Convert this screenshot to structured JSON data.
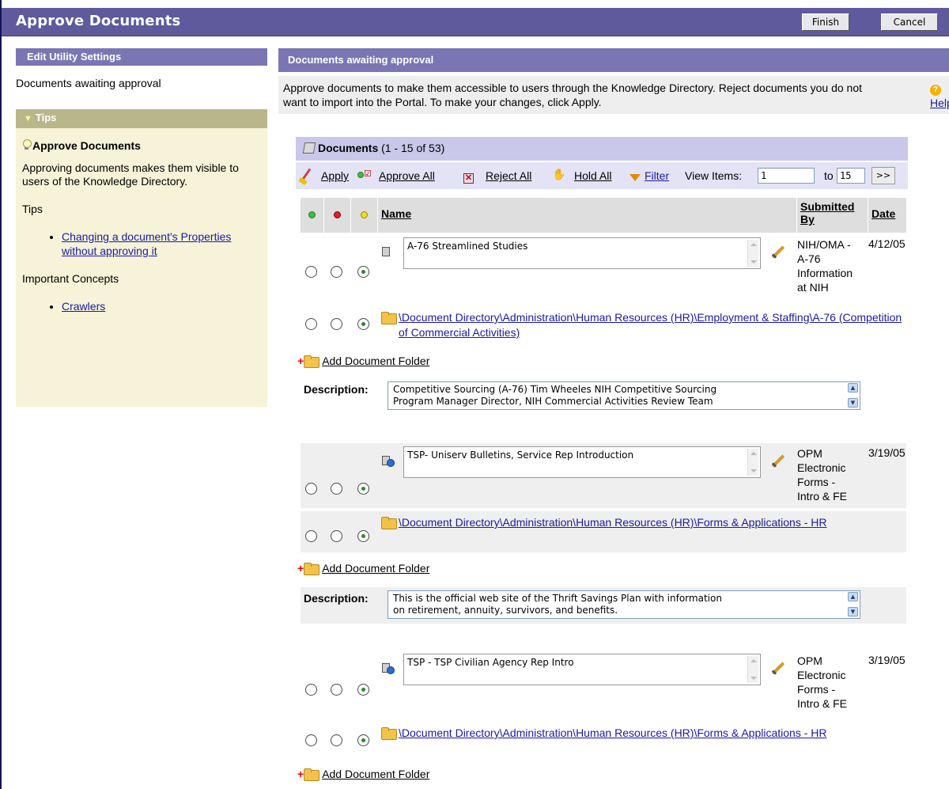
{
  "window": {
    "title": "Approve Documents",
    "finish_label": "Finish",
    "cancel_label": "Cancel"
  },
  "sidebar": {
    "header": "Edit Utility Settings",
    "current_item": "Documents awaiting approval",
    "tips_header": "Tips",
    "tip_title": "Approve Documents",
    "tip_text": "Approving documents makes them visible to users of the Knowledge Directory.",
    "tips_label": "Tips",
    "tips_links": [
      "Changing a document's Properties without approving it"
    ],
    "concepts_label": "Important Concepts",
    "concepts_links": [
      "Crawlers"
    ]
  },
  "main": {
    "header": "Documents awaiting approval",
    "intro": "Approve documents to make them accessible to users through the Knowledge Directory. Reject documents you do not want to import into the Portal. To make your changes, click Apply.",
    "help_label": "Help",
    "documents_label": "Documents",
    "documents_range": "(1 - 15 of 53)"
  },
  "toolbar": {
    "apply_label": "Apply",
    "approve_all_label": "Approve All",
    "reject_all_label": "Reject All",
    "hold_all_label": "Hold All",
    "filter_label": "Filter",
    "view_items_label": "View Items:",
    "from_value": "1",
    "to_label": "to",
    "to_value": "15",
    "next_label": ">>"
  },
  "columns": {
    "name": "Name",
    "submitted_by": "Submitted By",
    "date": "Date"
  },
  "documents": [
    {
      "name": "A-76 Streamlined Studies",
      "submitted_by": "NIH/OMA - A-76 Information at NIH",
      "date": "4/12/05",
      "folder_path": "\\Document Directory\\Administration\\Human Resources (HR)\\Employment & Staffing\\A-76 (Competition of Commercial Activities)",
      "add_folder_label": "Add Document Folder",
      "description_label": "Description:",
      "description": "Competitive Sourcing (A-76) Tim Wheeles NIH Competitive Sourcing\nProgram Manager Director, NIH Commercial Activities Review Team"
    },
    {
      "name": "TSP- Uniserv Bulletins, Service Rep Introduction",
      "submitted_by": "OPM Electronic Forms - Intro & FE",
      "date": "3/19/05",
      "folder_path": "\\Document Directory\\Administration\\Human Resources (HR)\\Forms & Applications - HR",
      "add_folder_label": "Add Document Folder",
      "description_label": "Description:",
      "description": "This is the official web site of the Thrift Savings Plan with information\non retirement, annuity, survivors, and benefits."
    },
    {
      "name": "TSP - TSP Civilian Agency Rep Intro",
      "submitted_by": "OPM Electronic Forms - Intro & FE",
      "date": "3/19/05",
      "folder_path": "\\Document Directory\\Administration\\Human Resources (HR)\\Forms & Applications - HR",
      "add_folder_label": "Add Document Folder"
    }
  ],
  "colors": {
    "title_bar": "#5e5a9c",
    "section_header": "#7a76b4",
    "tips_panel": "#f6f3d8",
    "link": "#1a1aa6"
  },
  "icons": {
    "help": "help-icon",
    "document": "document-icon",
    "folder": "folder-icon",
    "edit": "pencil-icon",
    "apply": "brush-icon",
    "approve": "green-dot-icon",
    "reject": "red-x-icon",
    "hold": "hand-icon",
    "filter": "funnel-icon"
  }
}
